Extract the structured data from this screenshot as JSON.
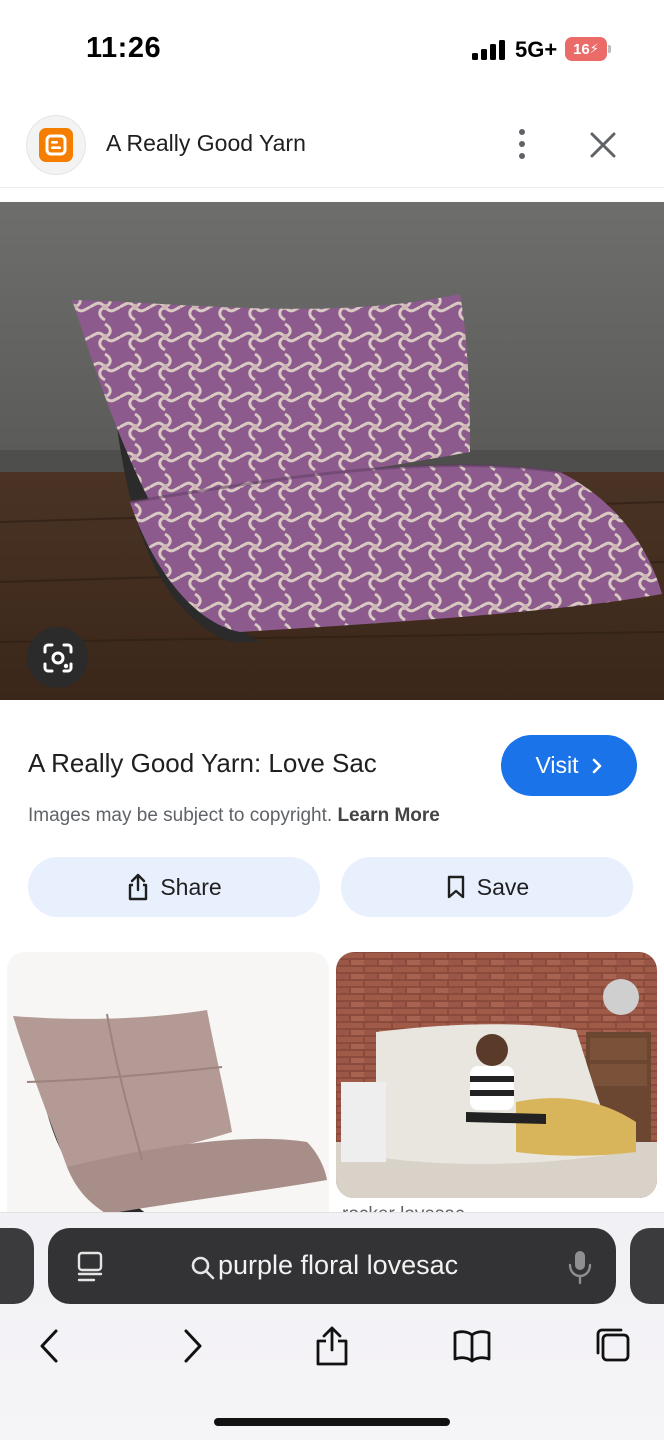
{
  "status_bar": {
    "time": "11:26",
    "network": "5G+",
    "battery": "16"
  },
  "header": {
    "site_name": "A Really Good Yarn",
    "logo_icon": "blogger-logo-icon",
    "more_icon": "more-vert-icon",
    "close_icon": "close-icon",
    "logo_color": "#f57d00"
  },
  "main_image": {
    "icon": "lens-icon"
  },
  "result": {
    "title": "A Really Good Yarn: Love Sac",
    "visit_label": "Visit",
    "copyright_text": "Images may be subject to copyright.",
    "learn_more": "Learn More",
    "share_label": "Share",
    "save_label": "Save",
    "accent_color": "#1a73e8",
    "pill_color": "#e8f0fe"
  },
  "related": {
    "caption": "rocker lovesac"
  },
  "browser": {
    "address_text": "purple floral lovesac",
    "icons": [
      "tab-overview-icon",
      "search-icon",
      "microphone-icon",
      "back-icon",
      "forward-icon",
      "share-icon",
      "bookmarks-icon",
      "tabs-icon"
    ]
  }
}
